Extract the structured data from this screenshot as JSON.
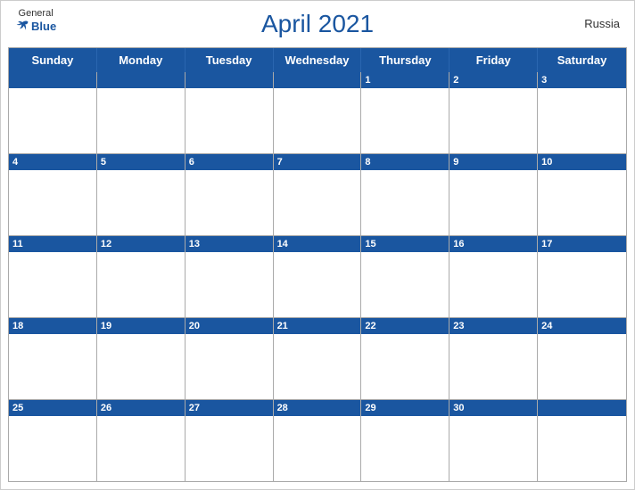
{
  "header": {
    "logo_general": "General",
    "logo_blue": "Blue",
    "title": "April 2021",
    "country": "Russia"
  },
  "calendar": {
    "days_of_week": [
      "Sunday",
      "Monday",
      "Tuesday",
      "Wednesday",
      "Thursday",
      "Friday",
      "Saturday"
    ],
    "weeks": [
      [
        null,
        null,
        null,
        null,
        1,
        2,
        3
      ],
      [
        4,
        5,
        6,
        7,
        8,
        9,
        10
      ],
      [
        11,
        12,
        13,
        14,
        15,
        16,
        17
      ],
      [
        18,
        19,
        20,
        21,
        22,
        23,
        24
      ],
      [
        25,
        26,
        27,
        28,
        29,
        30,
        null
      ]
    ],
    "accent_color": "#1a56a0"
  }
}
